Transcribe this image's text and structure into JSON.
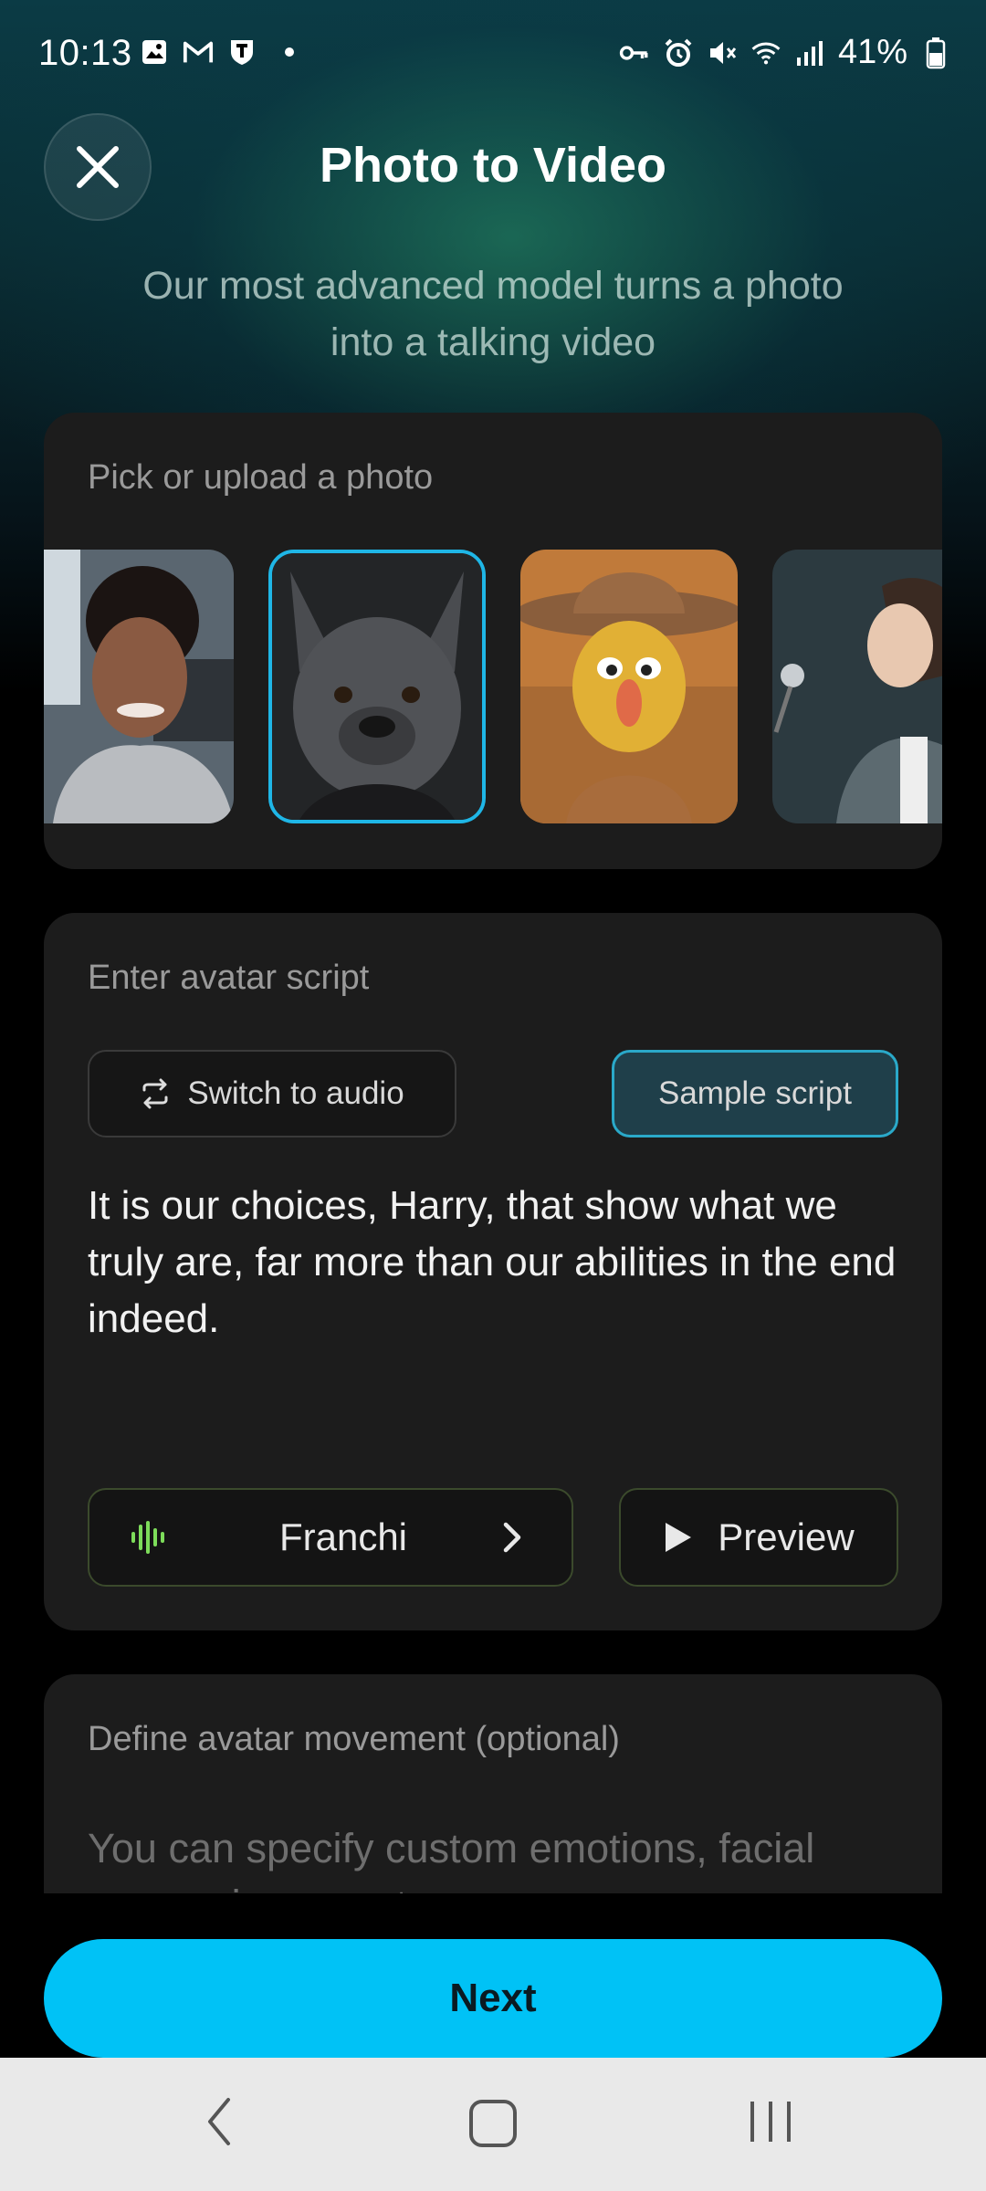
{
  "status_bar": {
    "time": "10:13",
    "battery": "41%",
    "icons_left": [
      "gallery-icon",
      "gmail-icon",
      "shield-t-icon",
      "dot"
    ],
    "icons_right": [
      "key-icon",
      "alarm-icon",
      "mute-icon",
      "wifi-icon",
      "signal-icon",
      "battery-icon"
    ]
  },
  "header": {
    "title": "Photo to Video",
    "subtitle": "Our most advanced model turns a photo into a talking video"
  },
  "photo_picker": {
    "label": "Pick or upload a photo",
    "photos": [
      {
        "name": "woman-selfie",
        "selected": false
      },
      {
        "name": "french-bulldog",
        "selected": true
      },
      {
        "name": "cowboy-character",
        "selected": false
      },
      {
        "name": "woman-singing",
        "selected": false
      }
    ]
  },
  "script": {
    "label": "Enter avatar script",
    "switch_label": "Switch to audio",
    "sample_label": "Sample script",
    "text": "It is our choices, Harry, that show what we truly are, far more than our abilities in the end indeed.",
    "voice_name": "Franchi",
    "preview_label": "Preview"
  },
  "movement": {
    "label": "Define avatar movement (optional)",
    "placeholder": "You can specify custom emotions, facial expressions, gestures, or persona"
  },
  "next_label": "Next",
  "colors": {
    "accent": "#00c2f6",
    "selected_border": "#1fb6e6",
    "card_bg": "#1c1c1c",
    "voice_wave": "#7ddc5a"
  }
}
